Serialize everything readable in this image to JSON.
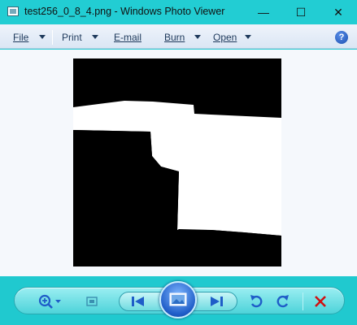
{
  "window": {
    "title": "test256_0_8_4.png - Windows Photo Viewer",
    "minimize_glyph": "—",
    "maximize_glyph": "☐",
    "close_glyph": "✕"
  },
  "menu": {
    "file": "File",
    "print": "Print",
    "email": "E-mail",
    "burn": "Burn",
    "open": "Open",
    "help_glyph": "?"
  },
  "controls": {
    "zoom": "zoom-icon",
    "fit": "actual-size-icon",
    "previous": "previous-icon",
    "slideshow": "slideshow-icon",
    "next": "next-icon",
    "rotate_left": "rotate-counterclockwise-icon",
    "rotate_right": "rotate-clockwise-icon",
    "delete": "delete-icon"
  },
  "colors": {
    "chrome": "#20c9cf",
    "menu_text": "#1e395b",
    "delete_red": "#d01010",
    "icon_blue": "#1f5dc8"
  }
}
